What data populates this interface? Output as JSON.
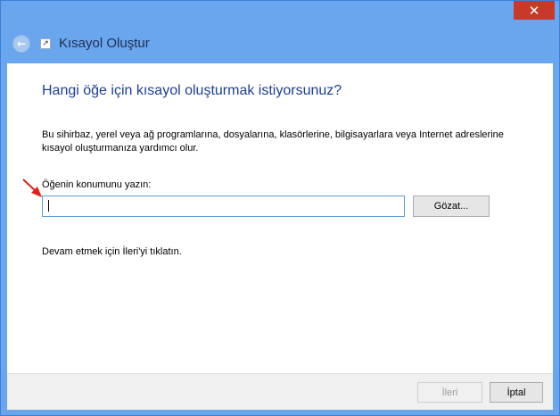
{
  "window": {
    "close_glyph": "✕",
    "colors": {
      "frame": "#6aa6ee",
      "close": "#c7392b",
      "heading": "#1c3e94"
    }
  },
  "header": {
    "title": "Kısayol Oluştur",
    "back_glyph": "←",
    "icon": "shortcut-arrow-icon"
  },
  "content": {
    "heading": "Hangi öğe için kısayol oluşturmak istiyorsunuz?",
    "description": "Bu sihirbaz, yerel veya ağ programlarına, dosyalarına, klasörlerine, bilgisayarlara veya Internet adreslerine kısayol oluşturmanıza yardımcı olur.",
    "location_label": "Öğenin konumunu yazın:",
    "location_value": "",
    "browse_label": "Gözat...",
    "hint": "Devam etmek için İleri'yi tıklatın."
  },
  "footer": {
    "next_label": "İleri",
    "cancel_label": "İptal"
  }
}
